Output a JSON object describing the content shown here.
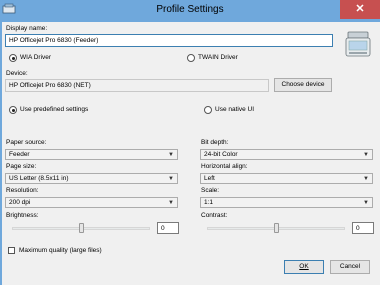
{
  "window": {
    "title": "Profile Settings",
    "close_glyph": "✕"
  },
  "display_name": {
    "label": "Display name:",
    "value": "HP Officejet Pro 6830 (Feeder)"
  },
  "driver": {
    "wia_label": "WIA Driver",
    "twain_label": "TWAIN Driver",
    "selected": "wia"
  },
  "device": {
    "label": "Device:",
    "value": "HP Officejet Pro 6830 (NET)",
    "choose_button": "Choose device"
  },
  "settings_mode": {
    "predefined_label": "Use predefined settings",
    "native_label": "Use native UI",
    "selected": "predefined"
  },
  "paper_source": {
    "label": "Paper source:",
    "value": "Feeder"
  },
  "bit_depth": {
    "label": "Bit depth:",
    "value": "24-bit Color"
  },
  "page_size": {
    "label": "Page size:",
    "value": "US Letter (8.5x11 in)"
  },
  "horizontal_align": {
    "label": "Horizontal align:",
    "value": "Left"
  },
  "resolution": {
    "label": "Resolution:",
    "value": "200 dpi"
  },
  "scale": {
    "label": "Scale:",
    "value": "1:1"
  },
  "brightness": {
    "label": "Brightness:",
    "value": "0",
    "level": 0.5
  },
  "contrast": {
    "label": "Contrast:",
    "value": "0",
    "level": 0.5
  },
  "max_quality": {
    "label": "Maximum quality (large files)",
    "checked": false
  },
  "buttons": {
    "ok": "OK",
    "cancel": "Cancel"
  },
  "icons": {
    "scanner": "scanner-icon",
    "app": "app-icon"
  }
}
